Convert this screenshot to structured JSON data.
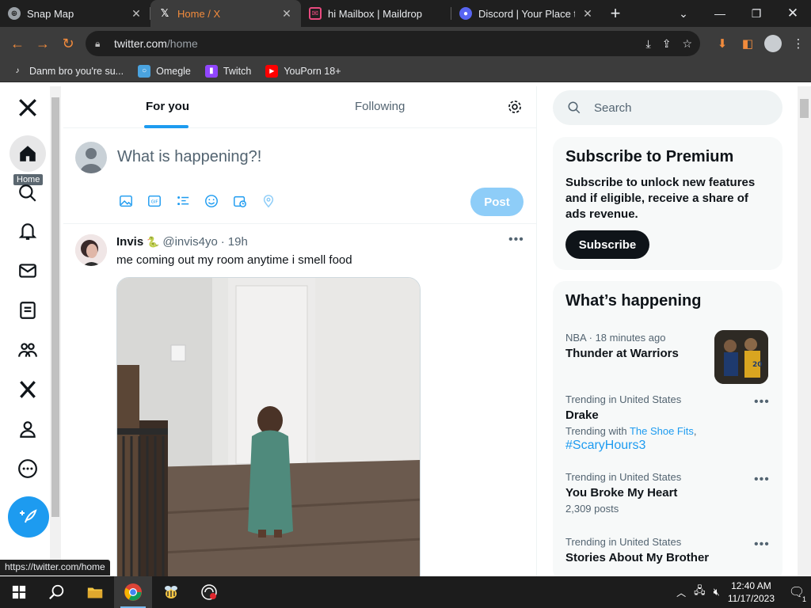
{
  "browser": {
    "tabs": [
      {
        "title": "Snap Map",
        "icon": "globe-icon"
      },
      {
        "title": "Home / X",
        "icon": "x-logo-icon"
      },
      {
        "title": "hi Mailbox | Maildrop",
        "icon": "maildrop-icon"
      },
      {
        "title": "Discord | Your Place to",
        "icon": "discord-icon"
      }
    ],
    "url_domain": "twitter.com",
    "url_path": "/home",
    "bookmarks": [
      {
        "label": "Danm bro you're su...",
        "icon": "tiktok-icon"
      },
      {
        "label": "Omegle",
        "icon": "omegle-icon"
      },
      {
        "label": "Twitch",
        "icon": "twitch-icon"
      },
      {
        "label": "YouPorn 18+",
        "icon": "youtube-icon"
      }
    ],
    "status_url": "https://twitter.com/home"
  },
  "nav": {
    "tooltip": "Home"
  },
  "feed": {
    "tab_for_you": "For you",
    "tab_following": "Following",
    "compose_placeholder": "What is happening?!",
    "post_button": "Post",
    "tweet": {
      "name": "Invis",
      "handle": "@invis4yo",
      "time": "19h",
      "text": "me coming out my room anytime i smell food"
    }
  },
  "sidebar": {
    "search_placeholder": "Search",
    "premium": {
      "title": "Subscribe to Premium",
      "text": "Subscribe to unlock new features and if eligible, receive a share of ads revenue.",
      "button": "Subscribe"
    },
    "happening": {
      "title": "What’s happening",
      "items": [
        {
          "meta": "NBA · 18 minutes ago",
          "title": "Thunder at Warriors"
        },
        {
          "meta": "Trending in United States",
          "title": "Drake",
          "sub_prefix": "Trending with",
          "link1": "The Shoe Fits",
          "link2": "#ScaryHours3"
        },
        {
          "meta": "Trending in United States",
          "title": "You Broke My Heart",
          "sub": "2,309 posts"
        },
        {
          "meta": "Trending in United States",
          "title": "Stories About My Brother"
        }
      ]
    }
  },
  "taskbar": {
    "time": "12:40 AM",
    "date": "11/17/2023",
    "notification_count": "1"
  },
  "colors": {
    "accent": "#1d9bf0",
    "chrome_dark": "#1f1f1f",
    "chrome_toolbar": "#3c3c3c"
  }
}
